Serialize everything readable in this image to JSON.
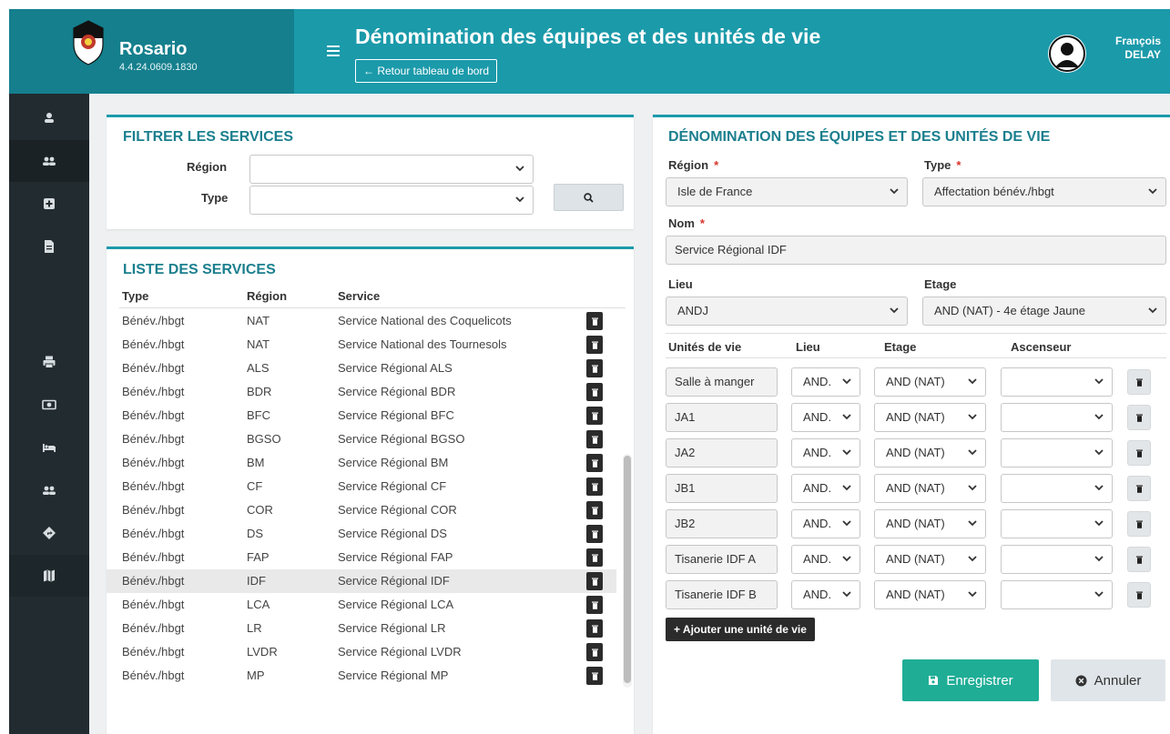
{
  "app": {
    "name": "Rosario",
    "version": "4.4.24.0609.1830"
  },
  "header": {
    "title": "Dénomination des équipes et des unités de vie",
    "back_label": "← Retour tableau de bord"
  },
  "user": {
    "first_name": "François",
    "last_name": "DELAY"
  },
  "sidebar": {
    "items": [
      {
        "icon": "user-icon"
      },
      {
        "icon": "users-icon"
      },
      {
        "icon": "medical-plus-icon"
      },
      {
        "icon": "file-icon"
      },
      {
        "icon": "print-icon"
      },
      {
        "icon": "money-icon"
      },
      {
        "icon": "bed-icon"
      },
      {
        "icon": "group-icon"
      },
      {
        "icon": "directions-icon"
      },
      {
        "icon": "map-icon"
      }
    ]
  },
  "filter": {
    "title": "FILTRER LES SERVICES",
    "region_label": "Région",
    "region_value": "",
    "type_label": "Type",
    "type_value": ""
  },
  "list": {
    "title": "LISTE DES SERVICES",
    "columns": [
      "Type",
      "Région",
      "Service"
    ],
    "rows": [
      {
        "type": "Bénév./hbgt",
        "region": "NAT",
        "service": "Service National des Coquelicots"
      },
      {
        "type": "Bénév./hbgt",
        "region": "NAT",
        "service": "Service National des Tournesols"
      },
      {
        "type": "Bénév./hbgt",
        "region": "ALS",
        "service": "Service Régional ALS"
      },
      {
        "type": "Bénév./hbgt",
        "region": "BDR",
        "service": "Service Régional BDR"
      },
      {
        "type": "Bénév./hbgt",
        "region": "BFC",
        "service": "Service Régional BFC"
      },
      {
        "type": "Bénév./hbgt",
        "region": "BGSO",
        "service": "Service Régional BGSO"
      },
      {
        "type": "Bénév./hbgt",
        "region": "BM",
        "service": "Service Régional BM"
      },
      {
        "type": "Bénév./hbgt",
        "region": "CF",
        "service": "Service Régional CF"
      },
      {
        "type": "Bénév./hbgt",
        "region": "COR",
        "service": "Service Régional COR"
      },
      {
        "type": "Bénév./hbgt",
        "region": "DS",
        "service": "Service Régional DS"
      },
      {
        "type": "Bénév./hbgt",
        "region": "FAP",
        "service": "Service Régional FAP"
      },
      {
        "type": "Bénév./hbgt",
        "region": "IDF",
        "service": "Service Régional IDF"
      },
      {
        "type": "Bénév./hbgt",
        "region": "LCA",
        "service": "Service Régional LCA"
      },
      {
        "type": "Bénév./hbgt",
        "region": "LR",
        "service": "Service Régional LR"
      },
      {
        "type": "Bénév./hbgt",
        "region": "LVDR",
        "service": "Service Régional LVDR"
      },
      {
        "type": "Bénév./hbgt",
        "region": "MP",
        "service": "Service Régional MP"
      }
    ]
  },
  "form": {
    "title": "DÉNOMINATION DES ÉQUIPES ET DES UNITÉS DE VIE",
    "region_label": "Région",
    "region_value": "Isle de France",
    "type_label": "Type",
    "type_value": "Affectation bénév./hbgt",
    "nom_label": "Nom",
    "nom_value": "Service Régional IDF",
    "lieu_label": "Lieu",
    "lieu_value": "ANDJ",
    "etage_label": "Etage",
    "etage_value": "AND (NAT) - 4e étage Jaune",
    "units_headers": [
      "Unités de vie",
      "Lieu",
      "Etage",
      "Ascenseur"
    ],
    "units": [
      {
        "name": "Salle à manger",
        "lieu": "AND.",
        "etage": "AND (NAT)",
        "ascenseur": ""
      },
      {
        "name": "JA1",
        "lieu": "AND.",
        "etage": "AND (NAT)",
        "ascenseur": ""
      },
      {
        "name": "JA2",
        "lieu": "AND.",
        "etage": "AND (NAT)",
        "ascenseur": ""
      },
      {
        "name": "JB1",
        "lieu": "AND.",
        "etage": "AND (NAT)",
        "ascenseur": ""
      },
      {
        "name": "JB2",
        "lieu": "AND.",
        "etage": "AND (NAT)",
        "ascenseur": ""
      },
      {
        "name": "Tisanerie IDF A",
        "lieu": "AND.",
        "etage": "AND (NAT)",
        "ascenseur": ""
      },
      {
        "name": "Tisanerie IDF B",
        "lieu": "AND.",
        "etage": "AND (NAT)",
        "ascenseur": ""
      }
    ],
    "add_label": "+ Ajouter une unité de vie",
    "save_label": "Enregistrer",
    "cancel_label": "Annuler"
  },
  "colors": {
    "accent": "#1b9aaa",
    "brand_dark": "#157f8d",
    "sidebar": "#222b30",
    "save": "#1fad96",
    "required": "#d9342b"
  }
}
